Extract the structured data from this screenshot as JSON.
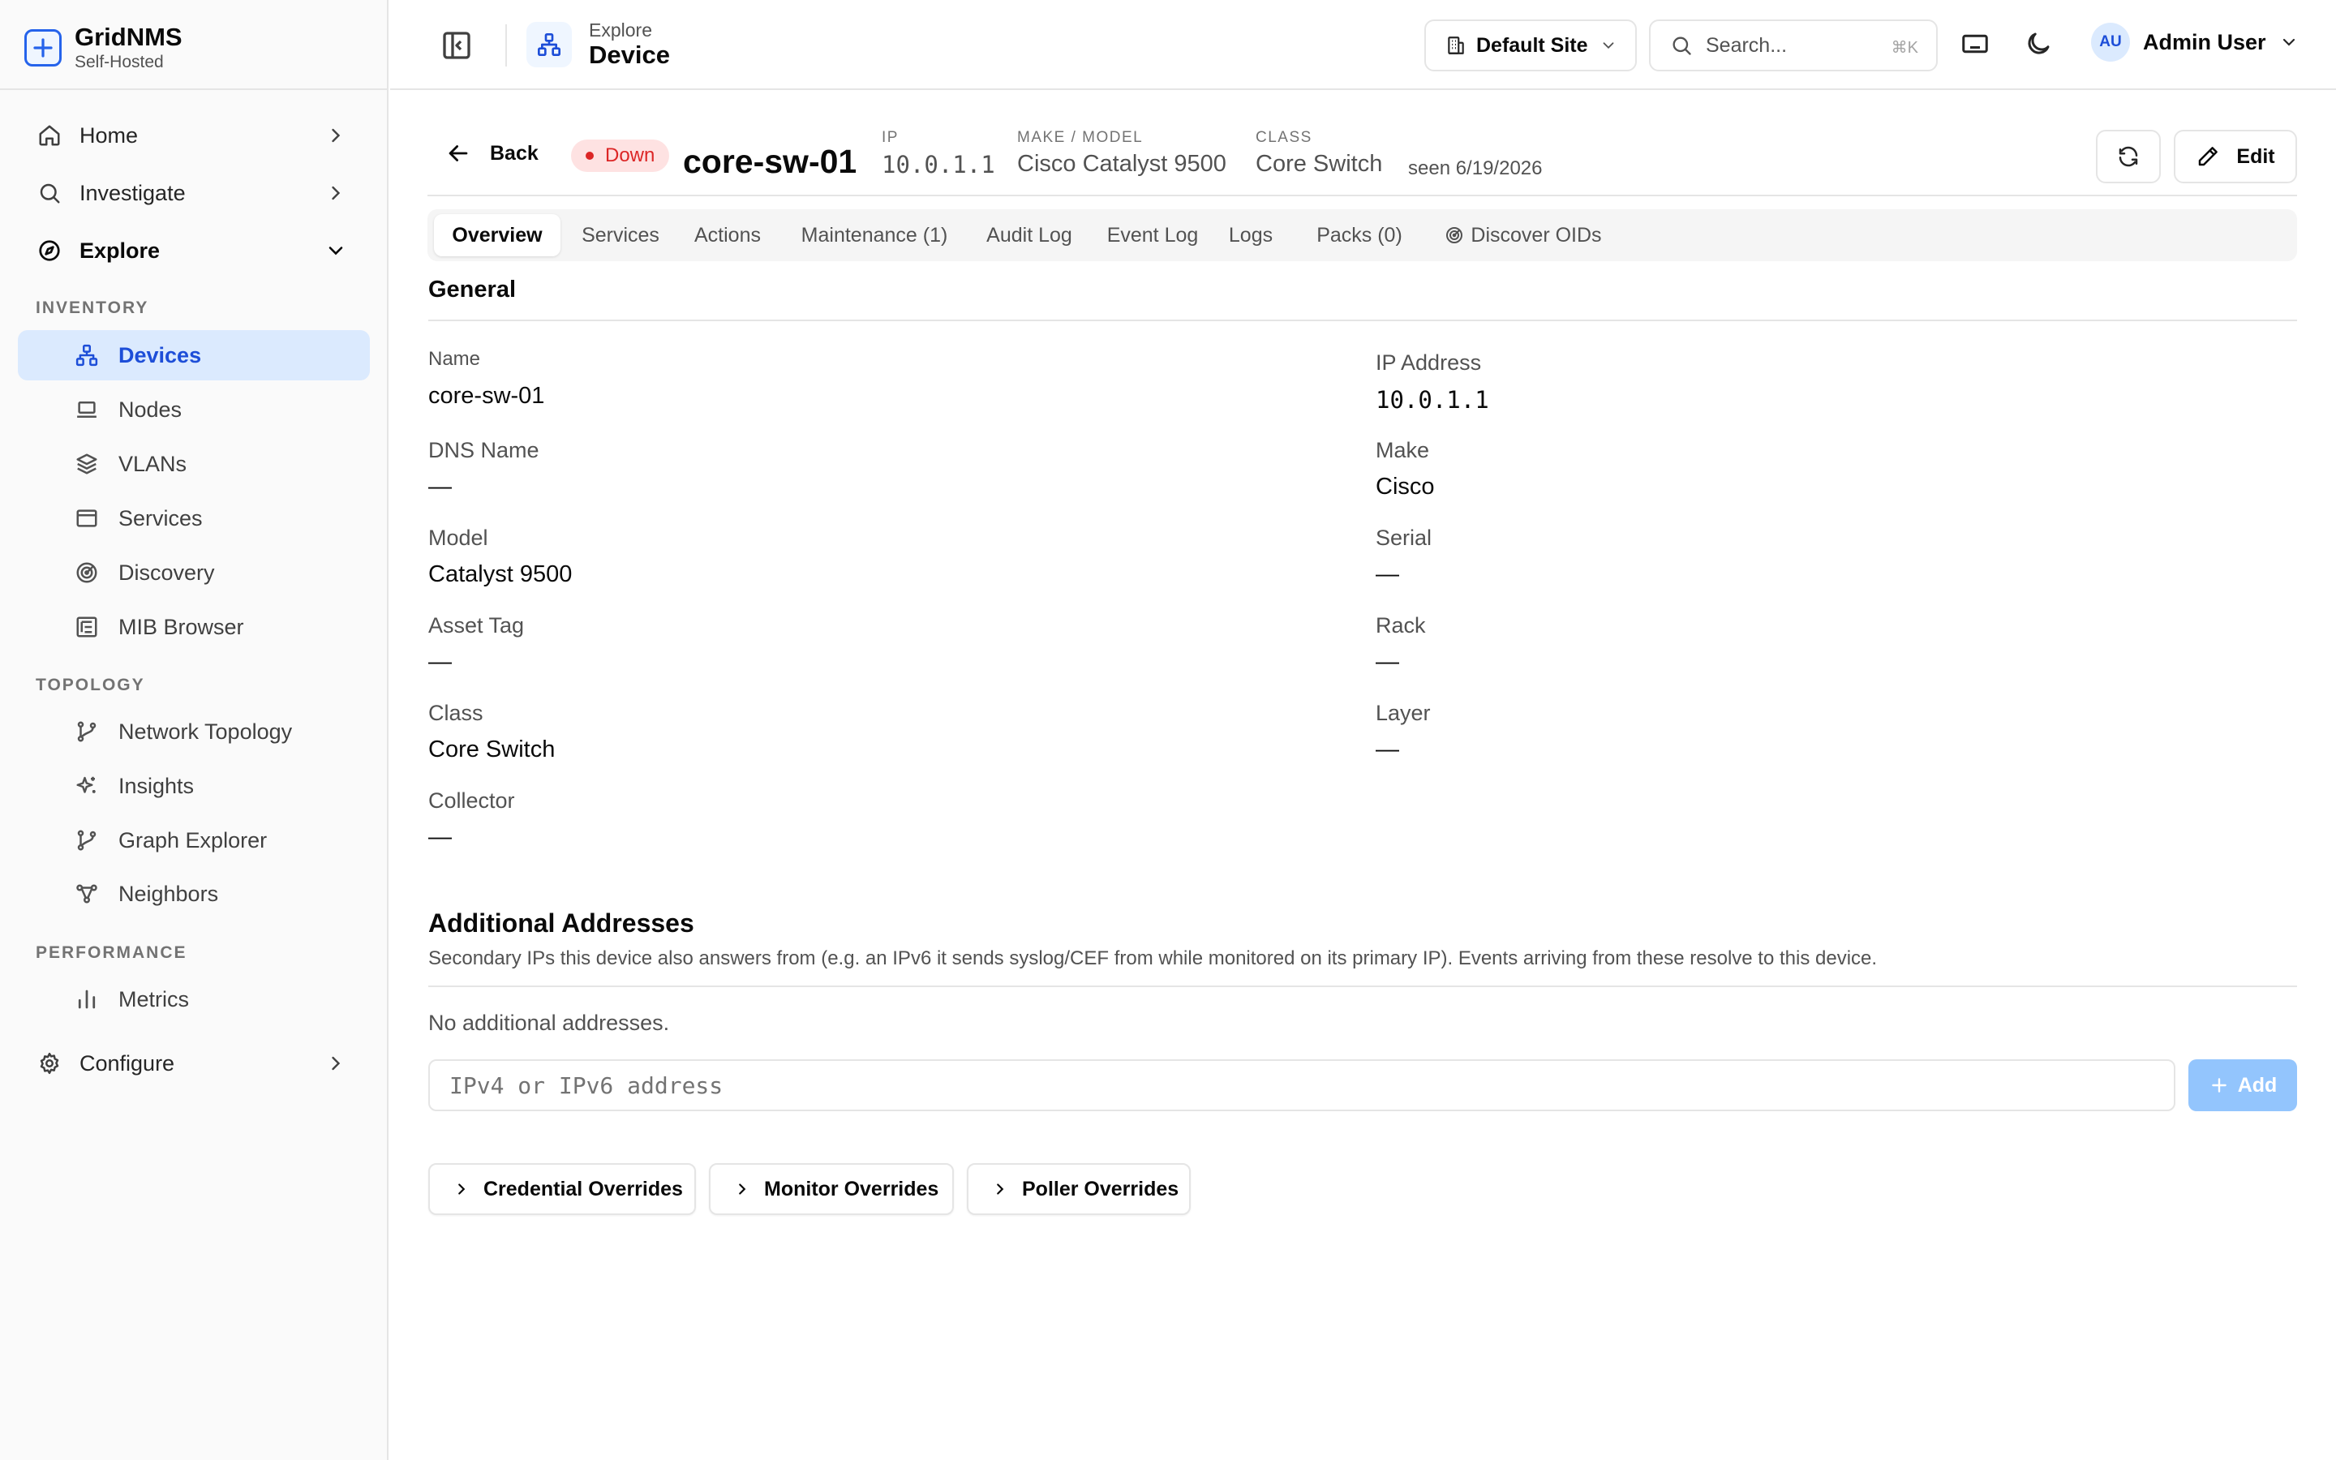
{
  "brand": {
    "name": "GridNMS",
    "subtitle": "Self-Hosted"
  },
  "sidebar": {
    "top_items": [
      {
        "label": "Home"
      },
      {
        "label": "Investigate"
      },
      {
        "label": "Explore"
      }
    ],
    "sections": {
      "inventory": "INVENTORY",
      "topology": "TOPOLOGY",
      "performance": "PERFORMANCE"
    },
    "inventory_items": [
      {
        "label": "Devices",
        "icon": "network-icon"
      },
      {
        "label": "Nodes",
        "icon": "laptop-icon"
      },
      {
        "label": "VLANs",
        "icon": "layers-icon"
      },
      {
        "label": "Services",
        "icon": "window-icon"
      },
      {
        "label": "Discovery",
        "icon": "radar-icon"
      },
      {
        "label": "MIB Browser",
        "icon": "tree-icon"
      }
    ],
    "topology_items": [
      {
        "label": "Network Topology",
        "icon": "git-branch-icon"
      },
      {
        "label": "Insights",
        "icon": "sparkles-icon"
      },
      {
        "label": "Graph Explorer",
        "icon": "git-branch-icon"
      },
      {
        "label": "Neighbors",
        "icon": "share-nodes-icon"
      }
    ],
    "performance_items": [
      {
        "label": "Metrics",
        "icon": "bar-chart-icon"
      }
    ],
    "configure": {
      "label": "Configure"
    }
  },
  "header": {
    "breadcrumb_parent": "Explore",
    "page_title": "Device",
    "site": "Default Site",
    "search_placeholder": "Search...",
    "search_shortcut": "⌘K",
    "user_initials": "AU",
    "user_name": "Admin User"
  },
  "device": {
    "back_label": "Back",
    "status": "Down",
    "name": "core-sw-01",
    "ip_label": "IP",
    "ip": "10.0.1.1",
    "make_model_label": "MAKE / MODEL",
    "make_model": "Cisco Catalyst 9500",
    "class_label": "CLASS",
    "class": "Core Switch",
    "seen": "seen 6/19/2026",
    "edit_label": "Edit"
  },
  "tabs": [
    {
      "label": "Overview"
    },
    {
      "label": "Services"
    },
    {
      "label": "Actions"
    },
    {
      "label": "Maintenance (1)"
    },
    {
      "label": "Audit Log"
    },
    {
      "label": "Event Log"
    },
    {
      "label": "Logs"
    },
    {
      "label": "Packs (0)"
    },
    {
      "label": "Discover OIDs"
    }
  ],
  "general": {
    "title": "General",
    "fields": {
      "name": {
        "label": "Name",
        "value": "core-sw-01"
      },
      "ip_address": {
        "label": "IP Address",
        "value": "10.0.1.1"
      },
      "dns_name": {
        "label": "DNS Name",
        "value": "—"
      },
      "make": {
        "label": "Make",
        "value": "Cisco"
      },
      "model": {
        "label": "Model",
        "value": "Catalyst 9500"
      },
      "serial": {
        "label": "Serial",
        "value": "—"
      },
      "asset_tag": {
        "label": "Asset Tag",
        "value": "—"
      },
      "rack": {
        "label": "Rack",
        "value": "—"
      },
      "class": {
        "label": "Class",
        "value": "Core Switch"
      },
      "layer": {
        "label": "Layer",
        "value": "—"
      },
      "collector": {
        "label": "Collector",
        "value": "—"
      }
    }
  },
  "additional_addresses": {
    "title": "Additional Addresses",
    "help": "Secondary IPs this device also answers from (e.g. an IPv6 it sends syslog/CEF from while monitored on its primary IP). Events arriving from these resolve to this device.",
    "empty": "No additional addresses.",
    "input_placeholder": "IPv4 or IPv6 address",
    "add_label": "Add"
  },
  "overrides": [
    {
      "label": "Credential Overrides"
    },
    {
      "label": "Monitor Overrides"
    },
    {
      "label": "Poller Overrides"
    }
  ],
  "colors": {
    "accent": "#2563eb",
    "active_nav_bg": "#dbeafe",
    "status_down": "#dc2626",
    "status_down_bg": "#fee2e2",
    "add_button": "#93c5fd"
  }
}
